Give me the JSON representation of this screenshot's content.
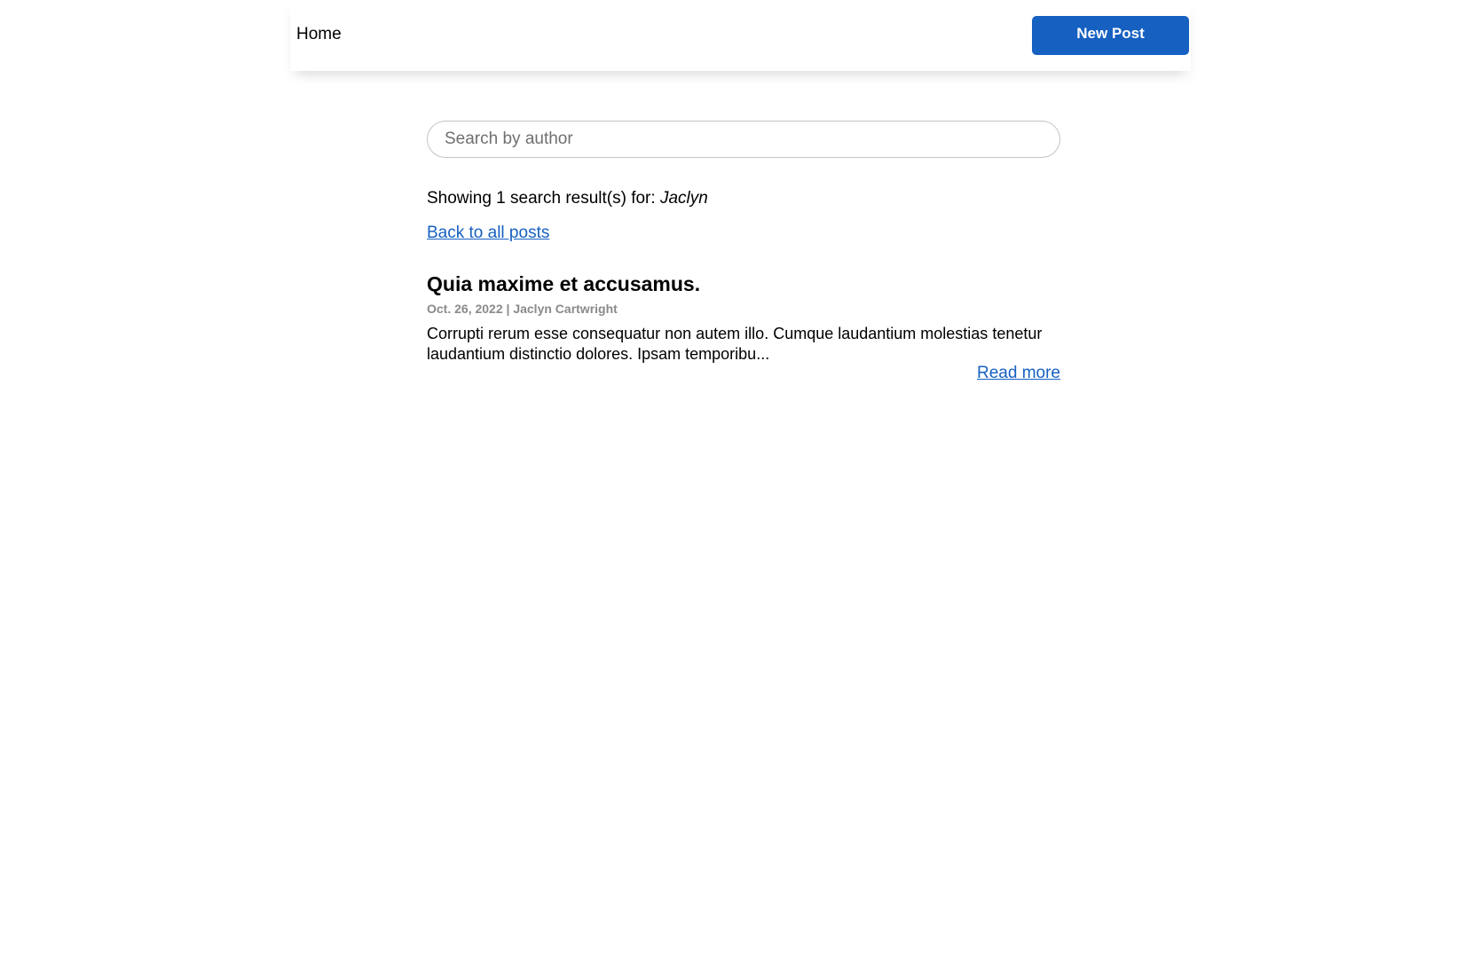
{
  "header": {
    "home_label": "Home",
    "new_post_label": "New Post"
  },
  "search": {
    "placeholder": "Search by author",
    "value": ""
  },
  "results": {
    "summary_prefix": "Showing 1 search result(s) for: ",
    "query": "Jaclyn",
    "back_label": "Back to all posts"
  },
  "posts": [
    {
      "title": "Quia maxime et accusamus.",
      "date": "Oct. 26, 2022",
      "separator": " | ",
      "author": "Jaclyn Cartwright",
      "excerpt": "Corrupti rerum esse consequatur non autem illo. Cumque laudantium molestias tenetur laudantium distinctio dolores. Ipsam temporibu...",
      "read_more_label": "Read more"
    }
  ],
  "colors": {
    "accent": "#1560c1",
    "meta_text": "#8a8a8a",
    "input_border": "#c4c4c4"
  }
}
